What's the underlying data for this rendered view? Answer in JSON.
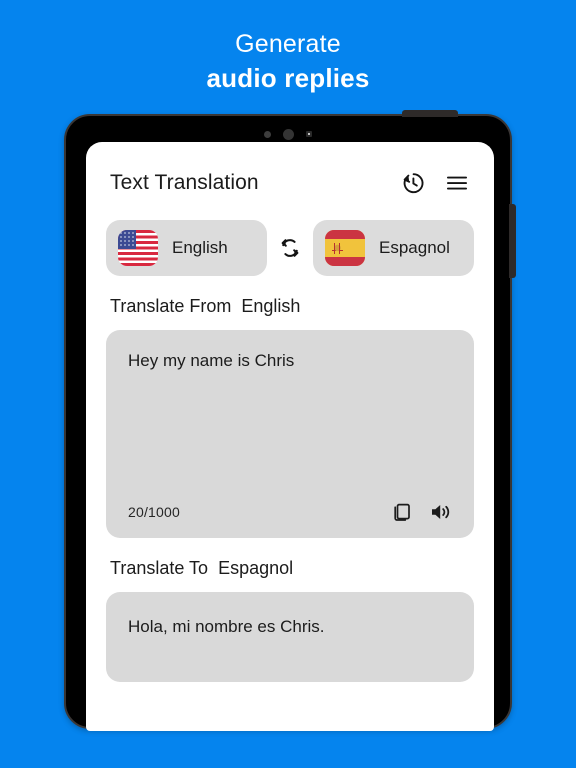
{
  "promo": {
    "line1": "Generate",
    "line2": "audio replies"
  },
  "colors": {
    "background": "#0584ee",
    "card": "#d9d9d9",
    "chip": "#dcdcdc",
    "text": "#1c1c1c",
    "device_frame": "#000000"
  },
  "app": {
    "title": "Text Translation",
    "history_icon": "history-icon",
    "menu_icon": "hamburger-menu-icon"
  },
  "languages": {
    "source": {
      "name": "English",
      "flag": "us-flag-icon"
    },
    "target": {
      "name": "Espagnol",
      "flag": "spain-flag-icon"
    },
    "swap_icon": "swap-languages-icon"
  },
  "input_section": {
    "label": "Translate From",
    "language": "English",
    "text": "Hey my name is Chris",
    "char_count": "20/1000",
    "copy_icon": "copy-icon",
    "speaker_icon": "speaker-icon"
  },
  "output_section": {
    "label": "Translate To",
    "language": "Espagnol",
    "text": "Hola, mi nombre es Chris."
  }
}
